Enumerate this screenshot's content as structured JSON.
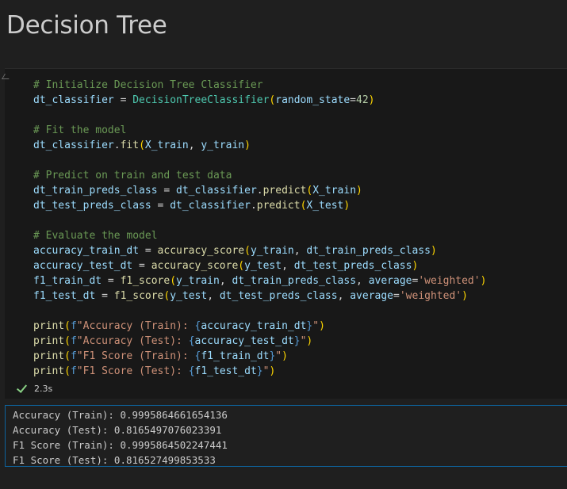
{
  "markdown": {
    "title": "Decision Tree"
  },
  "code_lines": [
    [
      [
        "c-com",
        "# Initialize Decision Tree Classifier"
      ]
    ],
    [
      [
        "c-var",
        "dt_classifier"
      ],
      [
        "c-op",
        " = "
      ],
      [
        "c-cls",
        "DecisionTreeClassifier"
      ],
      [
        "c-p1",
        "("
      ],
      [
        "c-var",
        "random_state"
      ],
      [
        "c-op",
        "="
      ],
      [
        "c-num",
        "42"
      ],
      [
        "c-p1",
        ")"
      ]
    ],
    [],
    [
      [
        "c-com",
        "# Fit the model"
      ]
    ],
    [
      [
        "c-var",
        "dt_classifier"
      ],
      [
        "c-op",
        "."
      ],
      [
        "c-fn",
        "fit"
      ],
      [
        "c-p1",
        "("
      ],
      [
        "c-var",
        "X_train"
      ],
      [
        "c-op",
        ", "
      ],
      [
        "c-var",
        "y_train"
      ],
      [
        "c-p1",
        ")"
      ]
    ],
    [],
    [
      [
        "c-com",
        "# Predict on train and test data"
      ]
    ],
    [
      [
        "c-var",
        "dt_train_preds_class"
      ],
      [
        "c-op",
        " = "
      ],
      [
        "c-var",
        "dt_classifier"
      ],
      [
        "c-op",
        "."
      ],
      [
        "c-fn",
        "predict"
      ],
      [
        "c-p1",
        "("
      ],
      [
        "c-var",
        "X_train"
      ],
      [
        "c-p1",
        ")"
      ]
    ],
    [
      [
        "c-var",
        "dt_test_preds_class"
      ],
      [
        "c-op",
        " = "
      ],
      [
        "c-var",
        "dt_classifier"
      ],
      [
        "c-op",
        "."
      ],
      [
        "c-fn",
        "predict"
      ],
      [
        "c-p1",
        "("
      ],
      [
        "c-var",
        "X_test"
      ],
      [
        "c-p1",
        ")"
      ]
    ],
    [],
    [
      [
        "c-com",
        "# Evaluate the model"
      ]
    ],
    [
      [
        "c-var",
        "accuracy_train_dt"
      ],
      [
        "c-op",
        " = "
      ],
      [
        "c-fn",
        "accuracy_score"
      ],
      [
        "c-p1",
        "("
      ],
      [
        "c-var",
        "y_train"
      ],
      [
        "c-op",
        ", "
      ],
      [
        "c-var",
        "dt_train_preds_class"
      ],
      [
        "c-p1",
        ")"
      ]
    ],
    [
      [
        "c-var",
        "accuracy_test_dt"
      ],
      [
        "c-op",
        " = "
      ],
      [
        "c-fn",
        "accuracy_score"
      ],
      [
        "c-p1",
        "("
      ],
      [
        "c-var",
        "y_test"
      ],
      [
        "c-op",
        ", "
      ],
      [
        "c-var",
        "dt_test_preds_class"
      ],
      [
        "c-p1",
        ")"
      ]
    ],
    [
      [
        "c-var",
        "f1_train_dt"
      ],
      [
        "c-op",
        " = "
      ],
      [
        "c-fn",
        "f1_score"
      ],
      [
        "c-p1",
        "("
      ],
      [
        "c-var",
        "y_train"
      ],
      [
        "c-op",
        ", "
      ],
      [
        "c-var",
        "dt_train_preds_class"
      ],
      [
        "c-op",
        ", "
      ],
      [
        "c-var",
        "average"
      ],
      [
        "c-op",
        "="
      ],
      [
        "c-str",
        "'weighted'"
      ],
      [
        "c-p1",
        ")"
      ]
    ],
    [
      [
        "c-var",
        "f1_test_dt"
      ],
      [
        "c-op",
        " = "
      ],
      [
        "c-fn",
        "f1_score"
      ],
      [
        "c-p1",
        "("
      ],
      [
        "c-var",
        "y_test"
      ],
      [
        "c-op",
        ", "
      ],
      [
        "c-var",
        "dt_test_preds_class"
      ],
      [
        "c-op",
        ", "
      ],
      [
        "c-var",
        "average"
      ],
      [
        "c-op",
        "="
      ],
      [
        "c-str",
        "'weighted'"
      ],
      [
        "c-p1",
        ")"
      ]
    ],
    [],
    [
      [
        "c-fn",
        "print"
      ],
      [
        "c-p1",
        "("
      ],
      [
        "c-kw",
        "f"
      ],
      [
        "c-str",
        "\"Accuracy (Train): "
      ],
      [
        "c-kw",
        "{"
      ],
      [
        "c-var",
        "accuracy_train_dt"
      ],
      [
        "c-kw",
        "}"
      ],
      [
        "c-str",
        "\""
      ],
      [
        "c-p1",
        ")"
      ]
    ],
    [
      [
        "c-fn",
        "print"
      ],
      [
        "c-p1",
        "("
      ],
      [
        "c-kw",
        "f"
      ],
      [
        "c-str",
        "\"Accuracy (Test): "
      ],
      [
        "c-kw",
        "{"
      ],
      [
        "c-var",
        "accuracy_test_dt"
      ],
      [
        "c-kw",
        "}"
      ],
      [
        "c-str",
        "\""
      ],
      [
        "c-p1",
        ")"
      ]
    ],
    [
      [
        "c-fn",
        "print"
      ],
      [
        "c-p1",
        "("
      ],
      [
        "c-kw",
        "f"
      ],
      [
        "c-str",
        "\"F1 Score (Train): "
      ],
      [
        "c-kw",
        "{"
      ],
      [
        "c-var",
        "f1_train_dt"
      ],
      [
        "c-kw",
        "}"
      ],
      [
        "c-str",
        "\""
      ],
      [
        "c-p1",
        ")"
      ]
    ],
    [
      [
        "c-fn",
        "print"
      ],
      [
        "c-p1",
        "("
      ],
      [
        "c-kw",
        "f"
      ],
      [
        "c-str",
        "\"F1 Score (Test): "
      ],
      [
        "c-kw",
        "{"
      ],
      [
        "c-var",
        "f1_test_dt"
      ],
      [
        "c-kw",
        "}"
      ],
      [
        "c-str",
        "\""
      ],
      [
        "c-p1",
        ")"
      ]
    ]
  ],
  "status": {
    "duration": "2.3s",
    "state_icon": "check-icon",
    "state_color": "#89d185"
  },
  "output": {
    "lines": [
      "Accuracy (Train): 0.9995864661654136",
      "Accuracy (Test): 0.8165497076023391",
      "F1 Score (Train): 0.9995864502247441",
      "F1 Score (Test): 0.816527499853533"
    ]
  },
  "colors": {
    "background": "#1f1f1f",
    "cell_background": "#181818",
    "output_border": "#0e639c"
  }
}
